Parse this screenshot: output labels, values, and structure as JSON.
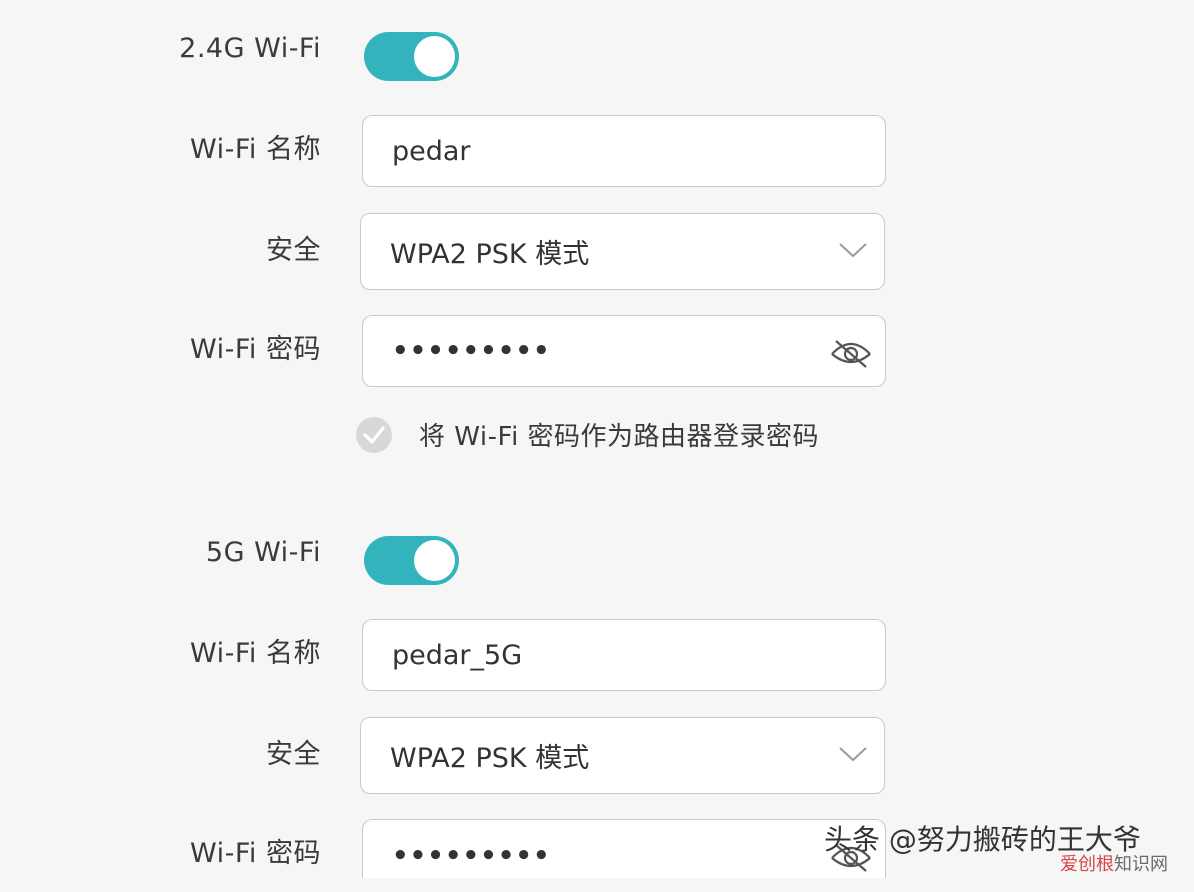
{
  "wifi_24g": {
    "toggle_label": "2.4G Wi-Fi",
    "enabled": true,
    "name_label": "Wi-Fi 名称",
    "name_value": "pedar",
    "security_label": "安全",
    "security_value": "WPA2 PSK 模式",
    "password_label": "Wi-Fi 密码",
    "password_masked": "•••••••••",
    "use_as_login_text": "将 Wi-Fi 密码作为路由器登录密码",
    "use_as_login_checked": true
  },
  "wifi_5g": {
    "toggle_label": "5G Wi-Fi",
    "enabled": true,
    "name_label": "Wi-Fi 名称",
    "name_value": "pedar_5G",
    "security_label": "安全",
    "security_value": "WPA2 PSK 模式",
    "password_label": "Wi-Fi 密码",
    "password_masked": "•••••••••"
  },
  "watermark": {
    "main": "头条 @努力搬砖的王大爷",
    "sub_red": "爱创根",
    "sub_gray": "知识网"
  },
  "colors": {
    "accent": "#33b4bd",
    "background": "#f6f6f6",
    "field_border": "#c9c9c9",
    "checkbox": "#d8d8d8"
  },
  "icons": {
    "password_visibility": "eye-slash-icon",
    "dropdown": "chevron-down-icon",
    "checkbox": "check-icon"
  }
}
